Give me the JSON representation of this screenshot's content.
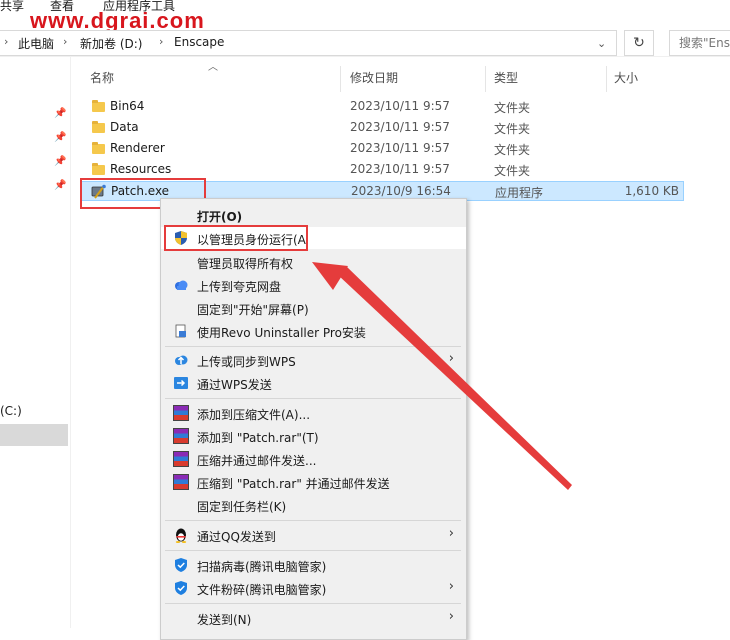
{
  "ribbon": {
    "tab_share": "共享",
    "tab_view": "查看",
    "tab_app_tools": "应用程序工具"
  },
  "watermark": "www.dgrai.com",
  "address": {
    "path": [
      "此电脑",
      "新加卷 (D:)",
      "Enscape"
    ],
    "search_placeholder": "搜索\"Enscape\""
  },
  "nav": {
    "drive_label": "(C:)"
  },
  "columns": {
    "name": "名称",
    "date": "修改日期",
    "type": "类型",
    "size": "大小"
  },
  "files": [
    {
      "name": "Bin64",
      "date": "2023/10/11 9:57",
      "type": "文件夹",
      "size": ""
    },
    {
      "name": "Data",
      "date": "2023/10/11 9:57",
      "type": "文件夹",
      "size": ""
    },
    {
      "name": "Renderer",
      "date": "2023/10/11 9:57",
      "type": "文件夹",
      "size": ""
    },
    {
      "name": "Resources",
      "date": "2023/10/11 9:57",
      "type": "文件夹",
      "size": ""
    },
    {
      "name": "Patch.exe",
      "date": "2023/10/9 16:54",
      "type": "应用程序",
      "size": "1,610 KB"
    }
  ],
  "context_menu": {
    "open": "打开(O)",
    "run_as_admin": "以管理员身份运行(A",
    "take_ownership": "管理员取得所有权",
    "upload_quark": "上传到夸克网盘",
    "pin_start": "固定到\"开始\"屏幕(P)",
    "revo": "使用Revo Uninstaller Pro安装",
    "wps_upload": "上传或同步到WPS",
    "wps_send": "通过WPS发送",
    "add_archive": "添加到压缩文件(A)...",
    "add_patch_rar": "添加到 \"Patch.rar\"(T)",
    "compress_email": "压缩并通过邮件发送...",
    "compress_patch_email": "压缩到 \"Patch.rar\" 并通过邮件发送",
    "pin_taskbar": "固定到任务栏(K)",
    "qq_send": "通过QQ发送到",
    "scan_virus": "扫描病毒(腾讯电脑管家)",
    "shred": "文件粉碎(腾讯电脑管家)",
    "send_to": "发送到(N)"
  },
  "colors": {
    "annotation_red": "#e53c3c",
    "selection": "#cce8ff",
    "watermark": "#d8161d"
  }
}
